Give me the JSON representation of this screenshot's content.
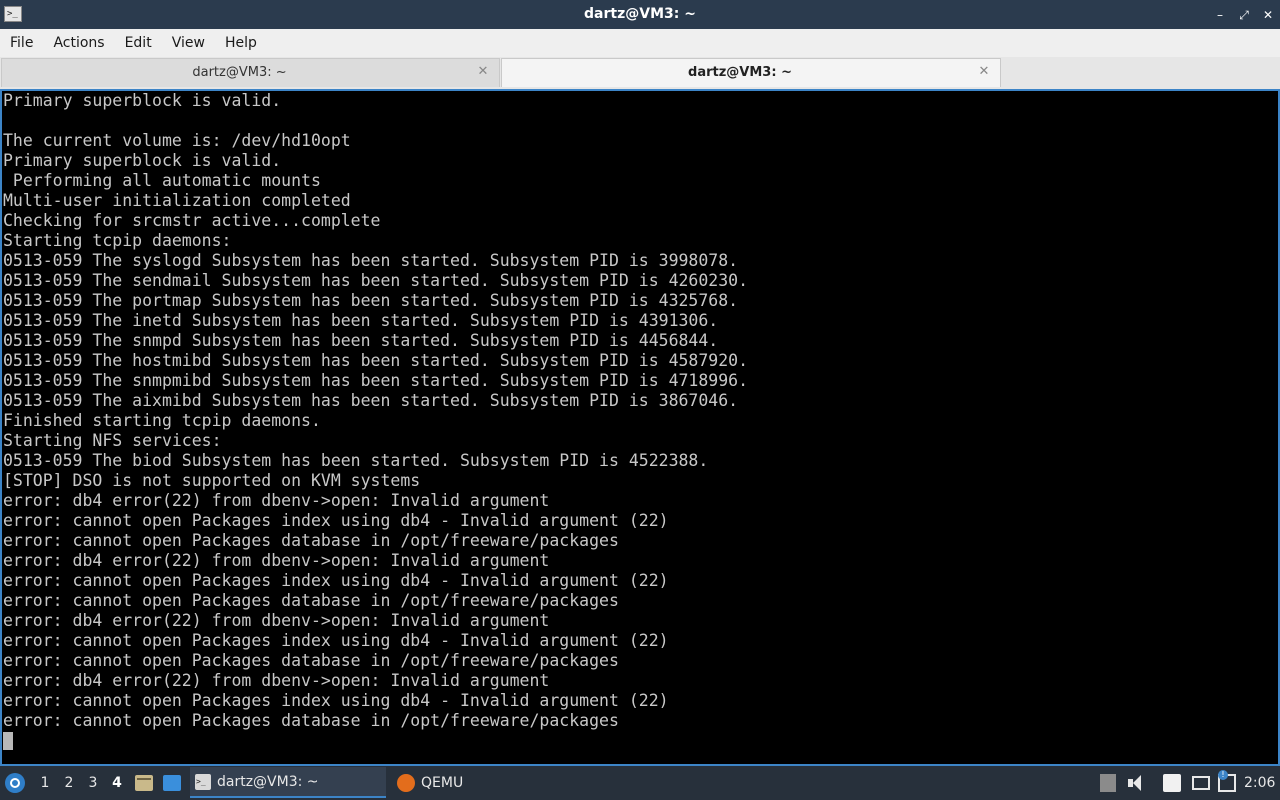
{
  "window": {
    "title": "dartz@VM3: ~",
    "app_icon": "terminal-icon",
    "controls": {
      "minimize": "–",
      "maximize": "⤢",
      "close": "✕"
    }
  },
  "menu": {
    "items": [
      "File",
      "Actions",
      "Edit",
      "View",
      "Help"
    ]
  },
  "tabs": [
    {
      "label": "dartz@VM3: ~",
      "active": false
    },
    {
      "label": "dartz@VM3: ~",
      "active": true
    }
  ],
  "terminal": {
    "lines": [
      "Primary superblock is valid.",
      "",
      "The current volume is: /dev/hd10opt",
      "Primary superblock is valid.",
      " Performing all automatic mounts",
      "Multi-user initialization completed",
      "Checking for srcmstr active...complete",
      "Starting tcpip daemons:",
      "0513-059 The syslogd Subsystem has been started. Subsystem PID is 3998078.",
      "0513-059 The sendmail Subsystem has been started. Subsystem PID is 4260230.",
      "0513-059 The portmap Subsystem has been started. Subsystem PID is 4325768.",
      "0513-059 The inetd Subsystem has been started. Subsystem PID is 4391306.",
      "0513-059 The snmpd Subsystem has been started. Subsystem PID is 4456844.",
      "0513-059 The hostmibd Subsystem has been started. Subsystem PID is 4587920.",
      "0513-059 The snmpmibd Subsystem has been started. Subsystem PID is 4718996.",
      "0513-059 The aixmibd Subsystem has been started. Subsystem PID is 3867046.",
      "Finished starting tcpip daemons.",
      "Starting NFS services:",
      "0513-059 The biod Subsystem has been started. Subsystem PID is 4522388.",
      "[STOP] DSO is not supported on KVM systems",
      "error: db4 error(22) from dbenv->open: Invalid argument",
      "error: cannot open Packages index using db4 - Invalid argument (22)",
      "error: cannot open Packages database in /opt/freeware/packages",
      "error: db4 error(22) from dbenv->open: Invalid argument",
      "error: cannot open Packages index using db4 - Invalid argument (22)",
      "error: cannot open Packages database in /opt/freeware/packages",
      "error: db4 error(22) from dbenv->open: Invalid argument",
      "error: cannot open Packages index using db4 - Invalid argument (22)",
      "error: cannot open Packages database in /opt/freeware/packages",
      "error: db4 error(22) from dbenv->open: Invalid argument",
      "error: cannot open Packages index using db4 - Invalid argument (22)",
      "error: cannot open Packages database in /opt/freeware/packages"
    ]
  },
  "taskbar": {
    "start_icon": "start-menu-icon",
    "workspaces": [
      "1",
      "2",
      "3",
      "4"
    ],
    "active_workspace": "4",
    "quick_launch": [
      "file-manager-icon",
      "show-desktop-icon"
    ],
    "tasks": [
      {
        "label": "dartz@VM3: ~",
        "icon": "terminal-icon",
        "active": true
      },
      {
        "label": "QEMU",
        "icon": "qemu-icon",
        "active": false
      }
    ],
    "tray": [
      "eject-icon",
      "volume-icon",
      "clipboard-icon",
      "display-icon",
      "network-icon"
    ],
    "clock": "2:06"
  }
}
